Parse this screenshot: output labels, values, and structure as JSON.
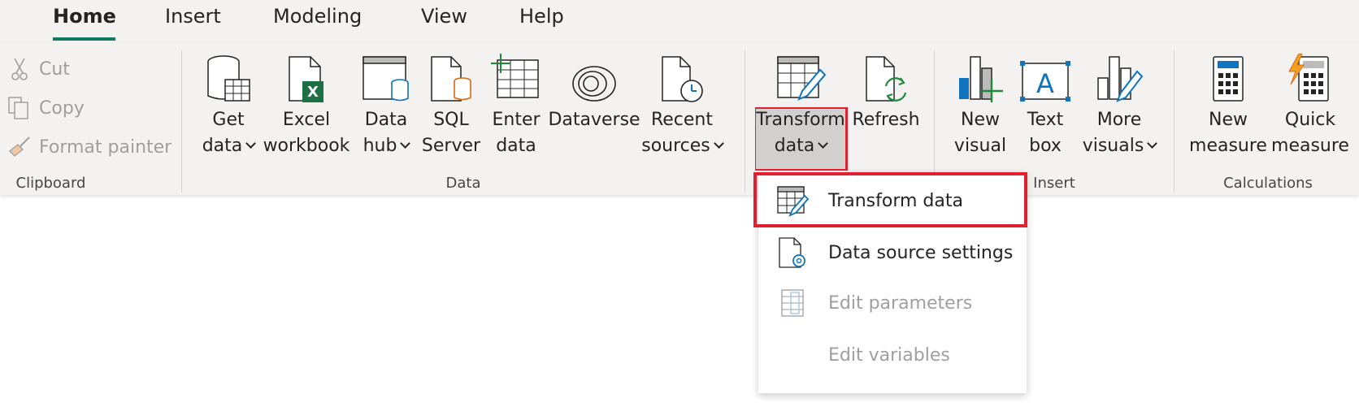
{
  "tabs": [
    {
      "label": "Home",
      "active": true
    },
    {
      "label": "Insert"
    },
    {
      "label": "Modeling"
    },
    {
      "label": "View"
    },
    {
      "label": "Help"
    }
  ],
  "clipboard": {
    "group_label": "Clipboard",
    "cut": "Cut",
    "copy": "Copy",
    "format_painter": "Format painter"
  },
  "data_group": {
    "group_label": "Data",
    "get_data": {
      "line1": "Get",
      "line2": "data"
    },
    "excel": {
      "line1": "Excel",
      "line2": "workbook"
    },
    "data_hub": {
      "line1": "Data",
      "line2": "hub"
    },
    "sql": {
      "line1": "SQL",
      "line2": "Server"
    },
    "enter": {
      "line1": "Enter",
      "line2": "data"
    },
    "dataverse": {
      "line1": "Dataverse"
    },
    "recent": {
      "line1": "Recent",
      "line2": "sources"
    }
  },
  "queries_group": {
    "transform": {
      "line1": "Transform",
      "line2": "data"
    },
    "refresh": {
      "line1": "Refresh"
    }
  },
  "insert_group": {
    "group_label": "Insert",
    "new_visual": {
      "line1": "New",
      "line2": "visual"
    },
    "text_box": {
      "line1": "Text",
      "line2": "box"
    },
    "more_visuals": {
      "line1": "More",
      "line2": "visuals"
    }
  },
  "calc_group": {
    "group_label": "Calculations",
    "new_measure": {
      "line1": "New",
      "line2": "measure"
    },
    "quick_measure": {
      "line1": "Quick",
      "line2": "measure"
    }
  },
  "dropdown": {
    "items": [
      {
        "label": "Transform data",
        "enabled": true,
        "icon": "table-pencil-icon"
      },
      {
        "label": "Data source settings",
        "enabled": true,
        "icon": "document-gear-icon"
      },
      {
        "label": "Edit parameters",
        "enabled": false,
        "icon": "parameters-icon"
      },
      {
        "label": "Edit variables",
        "enabled": false,
        "icon": ""
      }
    ]
  },
  "colors": {
    "accent_underline": "#117865",
    "highlight_red": "#e0202f",
    "ribbon_bg": "#f3f2f1",
    "disabled_text": "#a19f9d"
  }
}
